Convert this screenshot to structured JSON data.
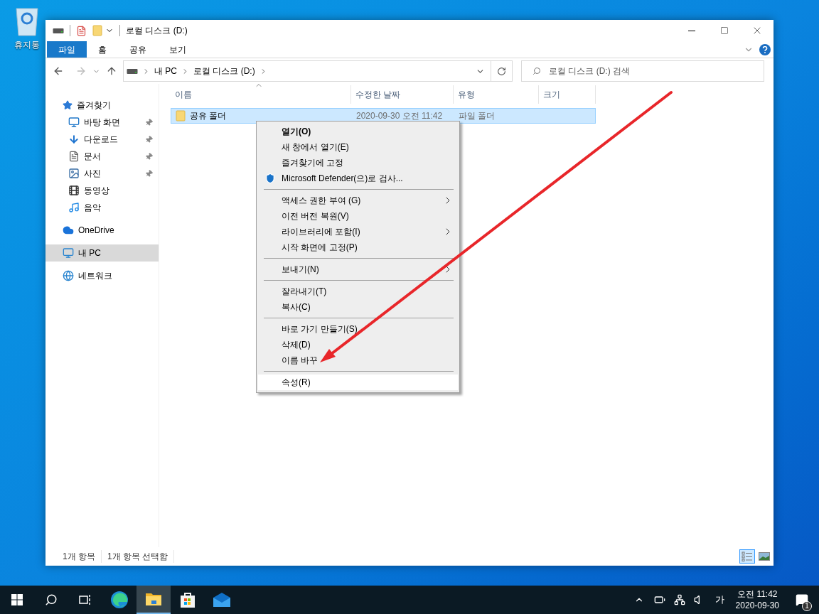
{
  "desktop_icons": [
    {
      "label": "휴지통"
    }
  ],
  "window": {
    "title": "로컬 디스크 (D:)",
    "ribbon_tabs": [
      {
        "label": "파일",
        "kind": "file",
        "selected": false
      },
      {
        "label": "홈",
        "kind": "tab",
        "selected": false
      },
      {
        "label": "공유",
        "kind": "tab",
        "selected": false
      },
      {
        "label": "보기",
        "kind": "tab",
        "selected": false
      }
    ],
    "breadcrumb": [
      "내 PC",
      "로컬 디스크 (D:)"
    ],
    "search": {
      "placeholder": "로컬 디스크 (D:) 검색"
    },
    "sidebar": {
      "items": [
        {
          "label": "즐겨찾기",
          "kind": "star",
          "selected": false,
          "children": [
            {
              "label": "바탕 화면",
              "kind": "desktop",
              "pinned": true,
              "selected": false
            },
            {
              "label": "다운로드",
              "kind": "download",
              "pinned": true,
              "selected": false
            },
            {
              "label": "문서",
              "kind": "document",
              "pinned": true,
              "selected": false
            },
            {
              "label": "사진",
              "kind": "picture",
              "pinned": true,
              "selected": false
            },
            {
              "label": "동영상",
              "kind": "film",
              "pinned": false,
              "selected": false
            },
            {
              "label": "음악",
              "kind": "music",
              "pinned": false,
              "selected": false
            }
          ]
        },
        {
          "label": "OneDrive",
          "kind": "cloud",
          "selected": false
        },
        {
          "label": "내 PC",
          "kind": "pc",
          "selected": true
        },
        {
          "label": "네트워크",
          "kind": "network",
          "selected": false
        }
      ]
    },
    "table": {
      "columns": [
        {
          "label": "이름",
          "sorted": true
        },
        {
          "label": "수정한 날짜",
          "sorted": false
        },
        {
          "label": "유형",
          "sorted": false
        },
        {
          "label": "크기",
          "sorted": false
        }
      ],
      "rows": [
        {
          "name": "공유 폴더",
          "date": "2020-09-30 오전 11:42",
          "type": "파일 폴더",
          "selected": true
        }
      ]
    },
    "status_bar": [
      "1개 항목",
      "1개 항목 선택함"
    ],
    "view_buttons": [
      {
        "kind": "details",
        "selected": true
      },
      {
        "kind": "thumbnails",
        "selected": false
      }
    ]
  },
  "context_menu": [
    {
      "kind": "item",
      "label": "열기(O)",
      "bold": true,
      "submenu": false,
      "selected": false
    },
    {
      "kind": "item",
      "label": "새 창에서 열기(E)",
      "bold": false,
      "submenu": false,
      "selected": false
    },
    {
      "kind": "item",
      "label": "즐겨찾기에 고정",
      "bold": false,
      "submenu": false,
      "selected": false
    },
    {
      "kind": "shield_item",
      "label": "Microsoft Defender(으)로 검사...",
      "bold": false,
      "submenu": false,
      "selected": false
    },
    {
      "kind": "separator"
    },
    {
      "kind": "item",
      "label": "액세스 권한 부여 (G)",
      "bold": false,
      "submenu": true,
      "selected": false
    },
    {
      "kind": "item",
      "label": "이전 버전 복원(V)",
      "bold": false,
      "submenu": false,
      "selected": false
    },
    {
      "kind": "item",
      "label": "라이브러리에 포함(I)",
      "bold": false,
      "submenu": true,
      "selected": false
    },
    {
      "kind": "item",
      "label": "시작 화면에 고정(P)",
      "bold": false,
      "submenu": false,
      "selected": false
    },
    {
      "kind": "separator"
    },
    {
      "kind": "item",
      "label": "보내기(N)",
      "bold": false,
      "submenu": true,
      "selected": false
    },
    {
      "kind": "separator"
    },
    {
      "kind": "item",
      "label": "잘라내기(T)",
      "bold": false,
      "submenu": false,
      "selected": false
    },
    {
      "kind": "item",
      "label": "복사(C)",
      "bold": false,
      "submenu": false,
      "selected": false
    },
    {
      "kind": "separator"
    },
    {
      "kind": "item",
      "label": "바로 가기 만들기(S)",
      "bold": false,
      "submenu": false,
      "selected": false
    },
    {
      "kind": "item",
      "label": "삭제(D)",
      "bold": false,
      "submenu": false,
      "selected": false
    },
    {
      "kind": "item",
      "label": "이름 바꾸",
      "bold": false,
      "submenu": false,
      "selected": false
    },
    {
      "kind": "separator"
    },
    {
      "kind": "item",
      "label": "속성(R)",
      "bold": false,
      "submenu": false,
      "selected": true
    }
  ],
  "taskbar": {
    "apps": [
      {
        "kind": "edge",
        "active": false
      },
      {
        "kind": "explorer",
        "active": true
      },
      {
        "kind": "store",
        "active": false
      },
      {
        "kind": "mail",
        "active": false
      }
    ],
    "ime": "가",
    "time": "오전 11:42",
    "date": "2020-09-30",
    "notification_count": "1"
  }
}
